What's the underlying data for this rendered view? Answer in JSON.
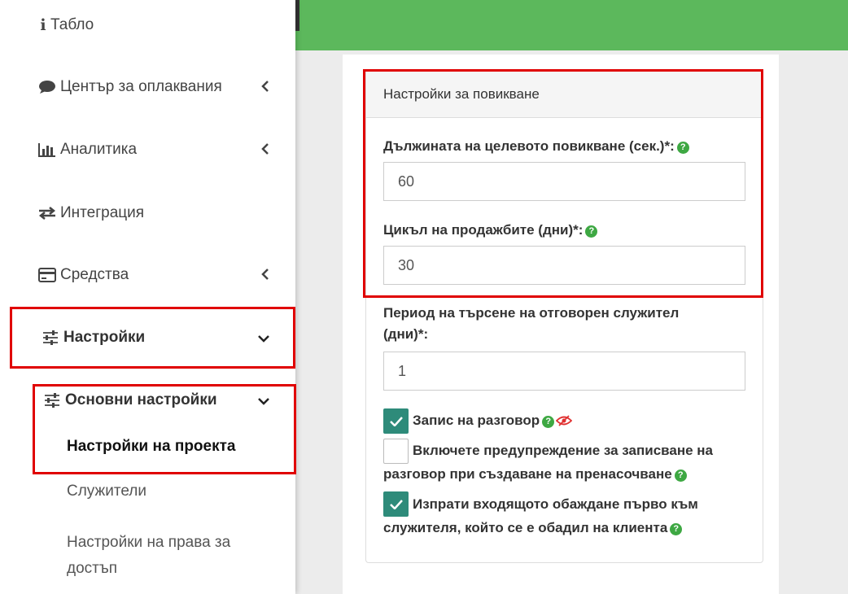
{
  "sidebar": {
    "dashboard": {
      "label": "Табло",
      "icon": "info-icon"
    },
    "complaints": {
      "label": "Център за оплаквания",
      "icon": "comment-icon"
    },
    "analytics": {
      "label": "Аналитика",
      "icon": "bar-chart-icon"
    },
    "integration": {
      "label": "Интеграция",
      "icon": "exchange-icon"
    },
    "funds": {
      "label": "Средства",
      "icon": "credit-card-icon"
    },
    "settings": {
      "label": "Настройки",
      "icon": "sliders-icon"
    },
    "basic_settings": {
      "label": "Основни настройки",
      "icon": "sliders-icon"
    },
    "sub_items": {
      "project_settings": "Настройки на проекта",
      "employees": "Служители",
      "access_rights_line1": "Настройки на права за",
      "access_rights_line2": "достъп"
    }
  },
  "panel": {
    "title": "Настройки за повикване",
    "fields": {
      "target_call_label": "Дължината на целевото повикване (сек.)*:",
      "target_call_value": "60",
      "sales_cycle_label": "Цикъл на продажбите (дни)*:",
      "sales_cycle_value": "30",
      "search_period_label_line1": "Период на търсене на отговорен служител",
      "search_period_label_line2": "(дни)*:",
      "search_period_value": "1"
    },
    "checkboxes": {
      "record": {
        "label": "Запис на разговор",
        "checked": true
      },
      "warning_line1": "Включете предупреждение за записване на",
      "warning_line2": "разговор при създаване на пренасочване",
      "warning_checked": false,
      "send_line1": "Изпрати входящото обаждане първо към",
      "send_line2": "служителя, който се е обадил на клиента",
      "send_checked": true
    },
    "help_symbol": "?"
  },
  "colors": {
    "topbar": "#5cb85c",
    "checkbox_on": "#2e8b7a",
    "help_icon": "#3ea843",
    "highlight_box": "#e00000"
  }
}
